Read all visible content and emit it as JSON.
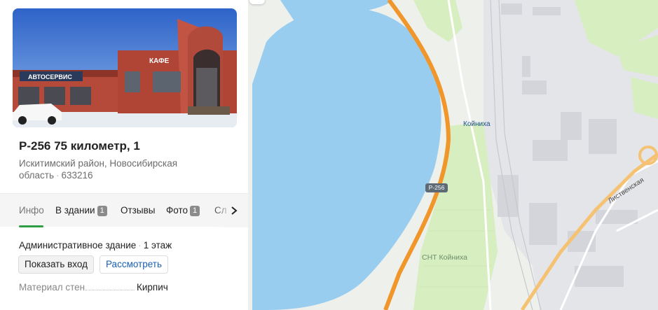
{
  "place": {
    "title": "Р-256 75 километр, 1",
    "district": "Искитимский район, Новосибирская область",
    "postcode": "633216",
    "photo_alt": "Здание с вывесками АВТОСЕРВИС и КАФЕ",
    "photo_signs": {
      "service": "АВТОСЕРВИС",
      "cafe": "КАФЕ"
    }
  },
  "tabs": [
    {
      "label": "Инфо",
      "active": true
    },
    {
      "label": "В здании",
      "count": "1"
    },
    {
      "label": "Отзывы"
    },
    {
      "label": "Фото",
      "count": "1"
    },
    {
      "label": "Сл"
    }
  ],
  "info": {
    "building_type": "Административное здание",
    "floors": "1 этаж",
    "show_entrance_label": "Показать вход",
    "view_label": "Рассмотреть",
    "material_key": "Материал стен",
    "material_value": "Кирпич"
  },
  "map": {
    "poi_label": "Койниха",
    "snt_label": "СНТ Койниха",
    "road_shield": "Р-256",
    "street_label": "Лиственская",
    "colors": {
      "water": "#98cdf0",
      "land": "#eef0ec",
      "park": "#d6eec0",
      "highway": "#f0962a",
      "pin": "#1a73e8"
    }
  }
}
